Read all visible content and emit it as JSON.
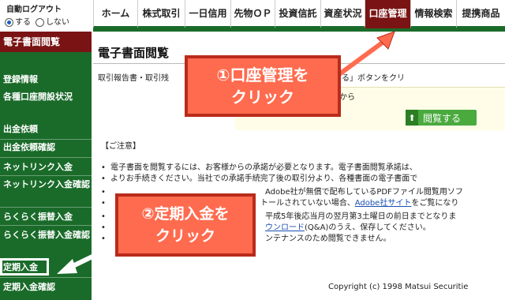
{
  "logout": {
    "title": "自動ログアウト",
    "option_on": "する",
    "option_off": "しない",
    "selected": "する"
  },
  "nav": {
    "tabs": [
      "ホーム",
      "株式取引",
      "一日信用",
      "先物ＯＰ",
      "投資信託",
      "資産状況",
      "口座管理",
      "情報検索",
      "提携商品"
    ],
    "active": "口座管理"
  },
  "sidebar": {
    "header": "電子書面閲覧",
    "items": [
      "登録情報",
      "各種口座開設状況",
      "出金依頼",
      "出金依頼確認",
      "ネットリンク入金",
      "ネットリンク入金確認",
      "らくらく振替入金",
      "らくらく振替入金確認",
      "定期入金",
      "定期入金確認"
    ],
    "highlighted": "定期入金"
  },
  "main": {
    "title": "電子書面閲覧",
    "intro_left": "取引報告書・取引残",
    "intro_right": "する場合、「閲覧する」ボタンをクリ",
    "intro_line2": "から",
    "view_button": "閲覧する",
    "notice_title": "【ご注意】",
    "notices": {
      "n1_a": "電子書面を閲覧するには、お客様からの承諾が必要となります。電子書面閲覧承諾は、",
      "n1_b": "よりお手続きください。当社での承諾手続完了後の取引分より、各種書面の電子書面で",
      "n2_a": "Adobe社が無償で配布しているPDFファイル閲覧用ソフ",
      "n2_b_pre": "トールされていない場合、",
      "n2_b_link": "Adobe社サイト",
      "n2_b_post": "をご覧になり",
      "n3_a": "平成5年後応当月の翌月第3土曜日の前日までとなりま",
      "n3_b_link": "ウンロード",
      "n3_b_post": "(Q&A)のうえ、保存してください。",
      "n4": "ンテナンスのため閲覧できません。"
    },
    "copyright": "Copyright (c) 1998 Matsui Securitie"
  },
  "callouts": {
    "c1_line1": "①口座管理を",
    "c1_line2": "クリック",
    "c2_line1": "②定期入金を",
    "c2_line2": "クリック"
  },
  "colors": {
    "header_green": "#1a6b2a",
    "active_tab": "#7a1414",
    "callout_fill": "#ff6b4f",
    "callout_border": "#b92b1b",
    "button_green": "#4aaa3e"
  }
}
